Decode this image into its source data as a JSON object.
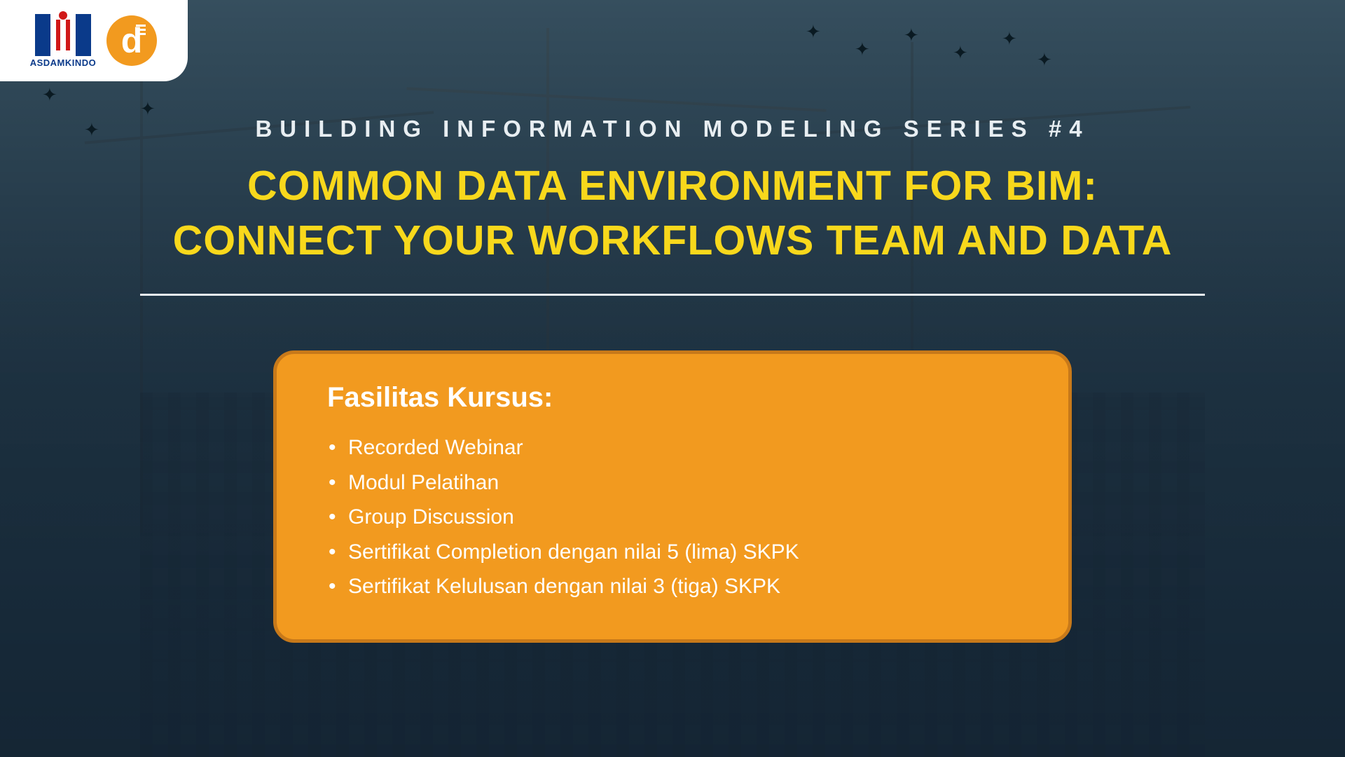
{
  "logo1_text": "ASDAMKINDO",
  "logo2_letter": "d",
  "series_label": "BUILDING INFORMATION MODELING SERIES #4",
  "title_line1": "COMMON DATA ENVIRONMENT FOR BIM:",
  "title_line2": "CONNECT YOUR WORKFLOWS TEAM AND DATA",
  "panel": {
    "heading": "Fasilitas Kursus:",
    "items": [
      "Recorded Webinar",
      "Modul Pelatihan",
      "Group Discussion",
      "Sertifikat Completion dengan nilai 5 (lima) SKPK",
      "Sertifikat Kelulusan dengan nilai 3 (tiga) SKPK"
    ]
  },
  "colors": {
    "accent_yellow": "#f8d81c",
    "panel_orange": "#f29a1f",
    "panel_border": "#c7791a"
  }
}
